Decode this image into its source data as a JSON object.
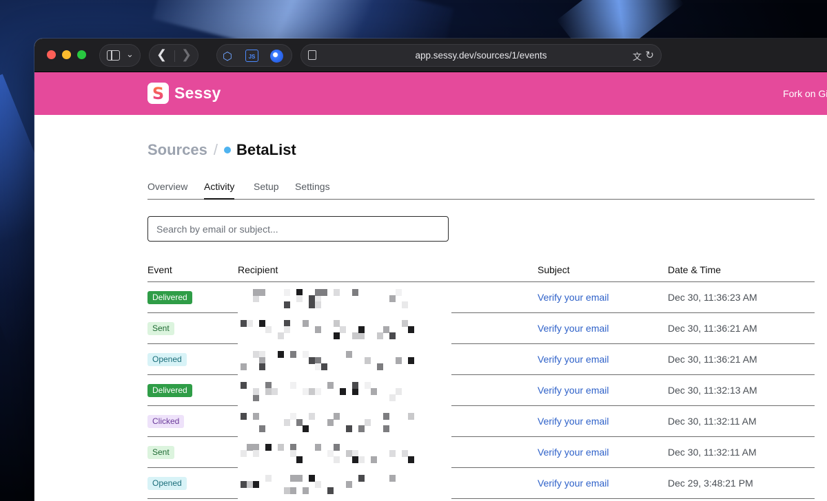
{
  "browser": {
    "url": "app.sessy.dev/sources/1/events",
    "icons": [
      "sidebar-icon",
      "chevron-down-icon",
      "back-icon",
      "forward-icon",
      "cube-extension-icon",
      "js-extension-icon",
      "globe-extension-icon",
      "page-icon",
      "translate-icon",
      "reload-icon"
    ]
  },
  "app": {
    "brand": "Sessy",
    "logo_letter": "S",
    "fork_link": "Fork on GitHub",
    "accent_color": "#e54a9b"
  },
  "breadcrumb": {
    "root": "Sources",
    "separator": "/",
    "current": "BetaList",
    "status_color": "#4fb3ef"
  },
  "tabs": [
    {
      "label": "Overview",
      "active": false
    },
    {
      "label": "Activity",
      "active": true
    },
    {
      "label": "Setup",
      "active": false
    },
    {
      "label": "Settings",
      "active": false
    }
  ],
  "search": {
    "placeholder": "Search by email or subject...",
    "value": ""
  },
  "table": {
    "columns": [
      "Event",
      "Recipient",
      "Subject",
      "Date & Time"
    ],
    "rows": [
      {
        "event": "Delivered",
        "subject": "Verify your email",
        "datetime": "Dec 30, 11:36:23 AM"
      },
      {
        "event": "Sent",
        "subject": "Verify your email",
        "datetime": "Dec 30, 11:36:21 AM"
      },
      {
        "event": "Opened",
        "subject": "Verify your email",
        "datetime": "Dec 30, 11:36:21 AM"
      },
      {
        "event": "Delivered",
        "subject": "Verify your email",
        "datetime": "Dec 30, 11:32:13 AM"
      },
      {
        "event": "Clicked",
        "subject": "Verify your email",
        "datetime": "Dec 30, 11:32:11 AM"
      },
      {
        "event": "Sent",
        "subject": "Verify your email",
        "datetime": "Dec 30, 11:32:11 AM"
      },
      {
        "event": "Opened",
        "subject": "Verify your email",
        "datetime": "Dec 29, 3:48:21 PM"
      }
    ]
  }
}
